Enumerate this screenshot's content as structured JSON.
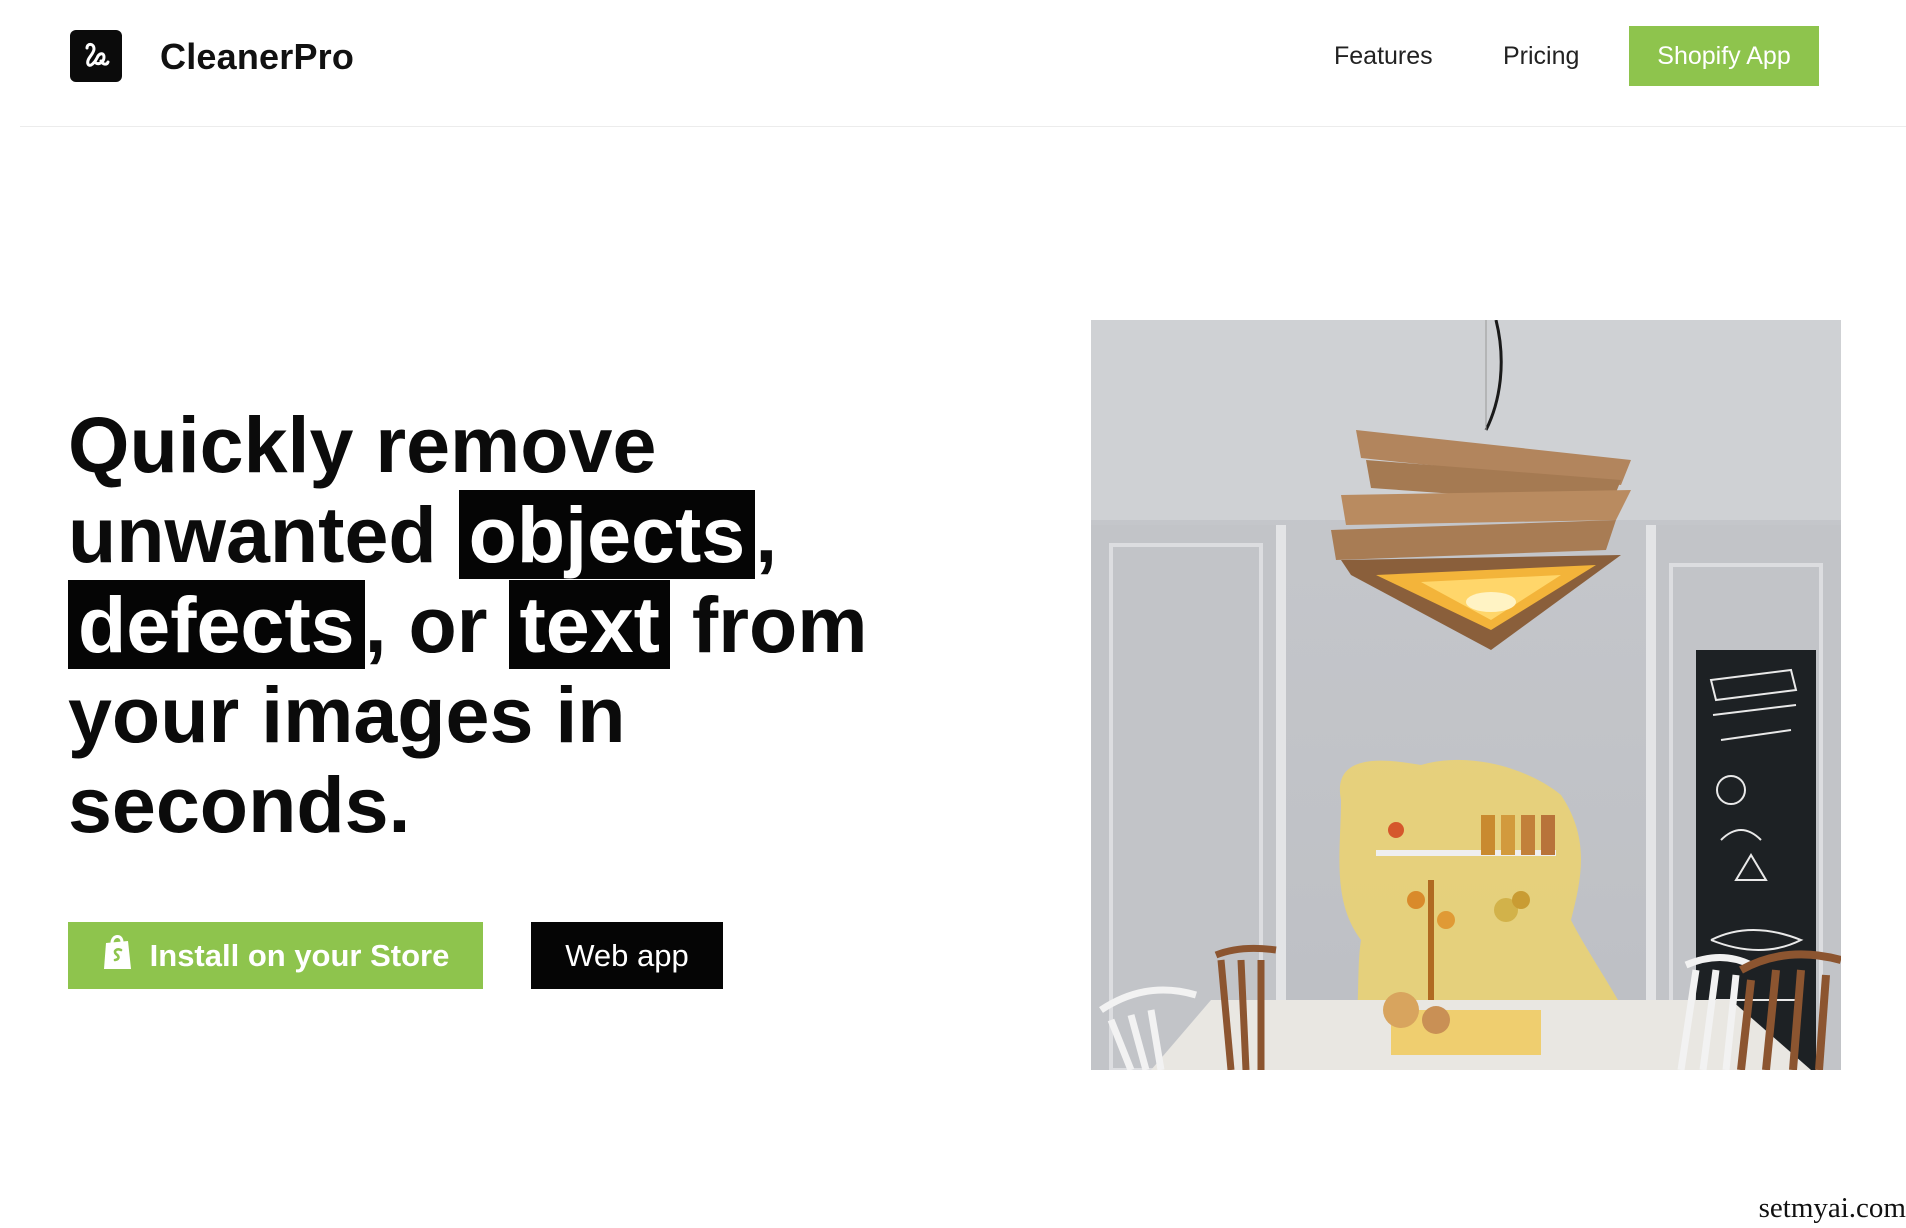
{
  "header": {
    "brand": "CleanerPro",
    "nav": {
      "features": "Features",
      "pricing": "Pricing"
    },
    "cta": "Shopify App"
  },
  "hero": {
    "title_parts": {
      "p1": "Quickly remove unwanted ",
      "hl1": "objects",
      "p2": ", ",
      "hl2": "defects",
      "p3": ", or ",
      "hl3": "text",
      "p4": " from your images in seconds."
    },
    "buttons": {
      "install": "Install on your Store",
      "webapp": "Web app"
    },
    "image_alt": "dining room with wooden pendant lamp and highlighted object area"
  },
  "icons": {
    "logo": "logo-mark-icon",
    "shopify_bag": "shopify-bag-icon"
  },
  "colors": {
    "accent_green": "#8ec44d",
    "black": "#050505",
    "highlight_yellow": "#f4d65f"
  },
  "watermark": "setmyai.com"
}
